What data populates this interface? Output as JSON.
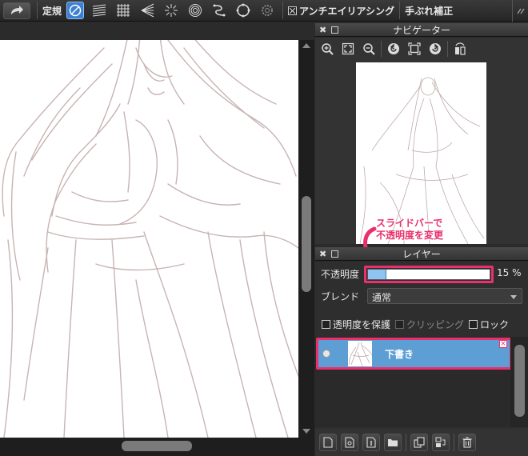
{
  "toolbar": {
    "ruler_label": "定規",
    "antialias_label": "アンチエイリアシング",
    "antialias_checked": true,
    "stabilizer_label": "手ぶれ補正",
    "icons": [
      "redo-icon",
      "ruler-off-icon",
      "parallel-lines-icon",
      "grid-icon",
      "perspective-icon",
      "radial-icon",
      "concentric-icon",
      "curve-icon",
      "circle-icon",
      "settings-icon",
      "more-icon"
    ],
    "active_color": "#3d7fd0"
  },
  "navigator": {
    "title": "ナビゲーター",
    "tools": [
      "zoom-in-icon",
      "fit-icon",
      "zoom-out-icon",
      "rotate-left-icon",
      "reset-icon",
      "rotate-right-icon",
      "flip-icon"
    ]
  },
  "layer_panel": {
    "title": "レイヤー",
    "opacity_label": "不透明度",
    "opacity_value": "15 %",
    "opacity_fraction": 0.15,
    "blend_label": "ブレンド",
    "blend_value": "通常",
    "protect_alpha_label": "透明度を保護",
    "clipping_label": "クリッピング",
    "lock_label": "ロック",
    "layers": [
      {
        "name": "下書き",
        "visible": true,
        "selected": true
      }
    ],
    "tools": [
      "new-layer-icon",
      "new-halftone-layer-icon",
      "new-8bit-layer-icon",
      "new-folder-icon",
      "duplicate-layer-icon",
      "merge-down-icon",
      "delete-layer-icon"
    ]
  },
  "annotation": {
    "line1": "スライドバーで",
    "line2": "不透明度を変更",
    "color": "#e8306c"
  },
  "colors": {
    "layer_selected": "#5d9fd5",
    "slider_fill": "#8fc4f2",
    "sketch_line": "#c9b3b3"
  }
}
